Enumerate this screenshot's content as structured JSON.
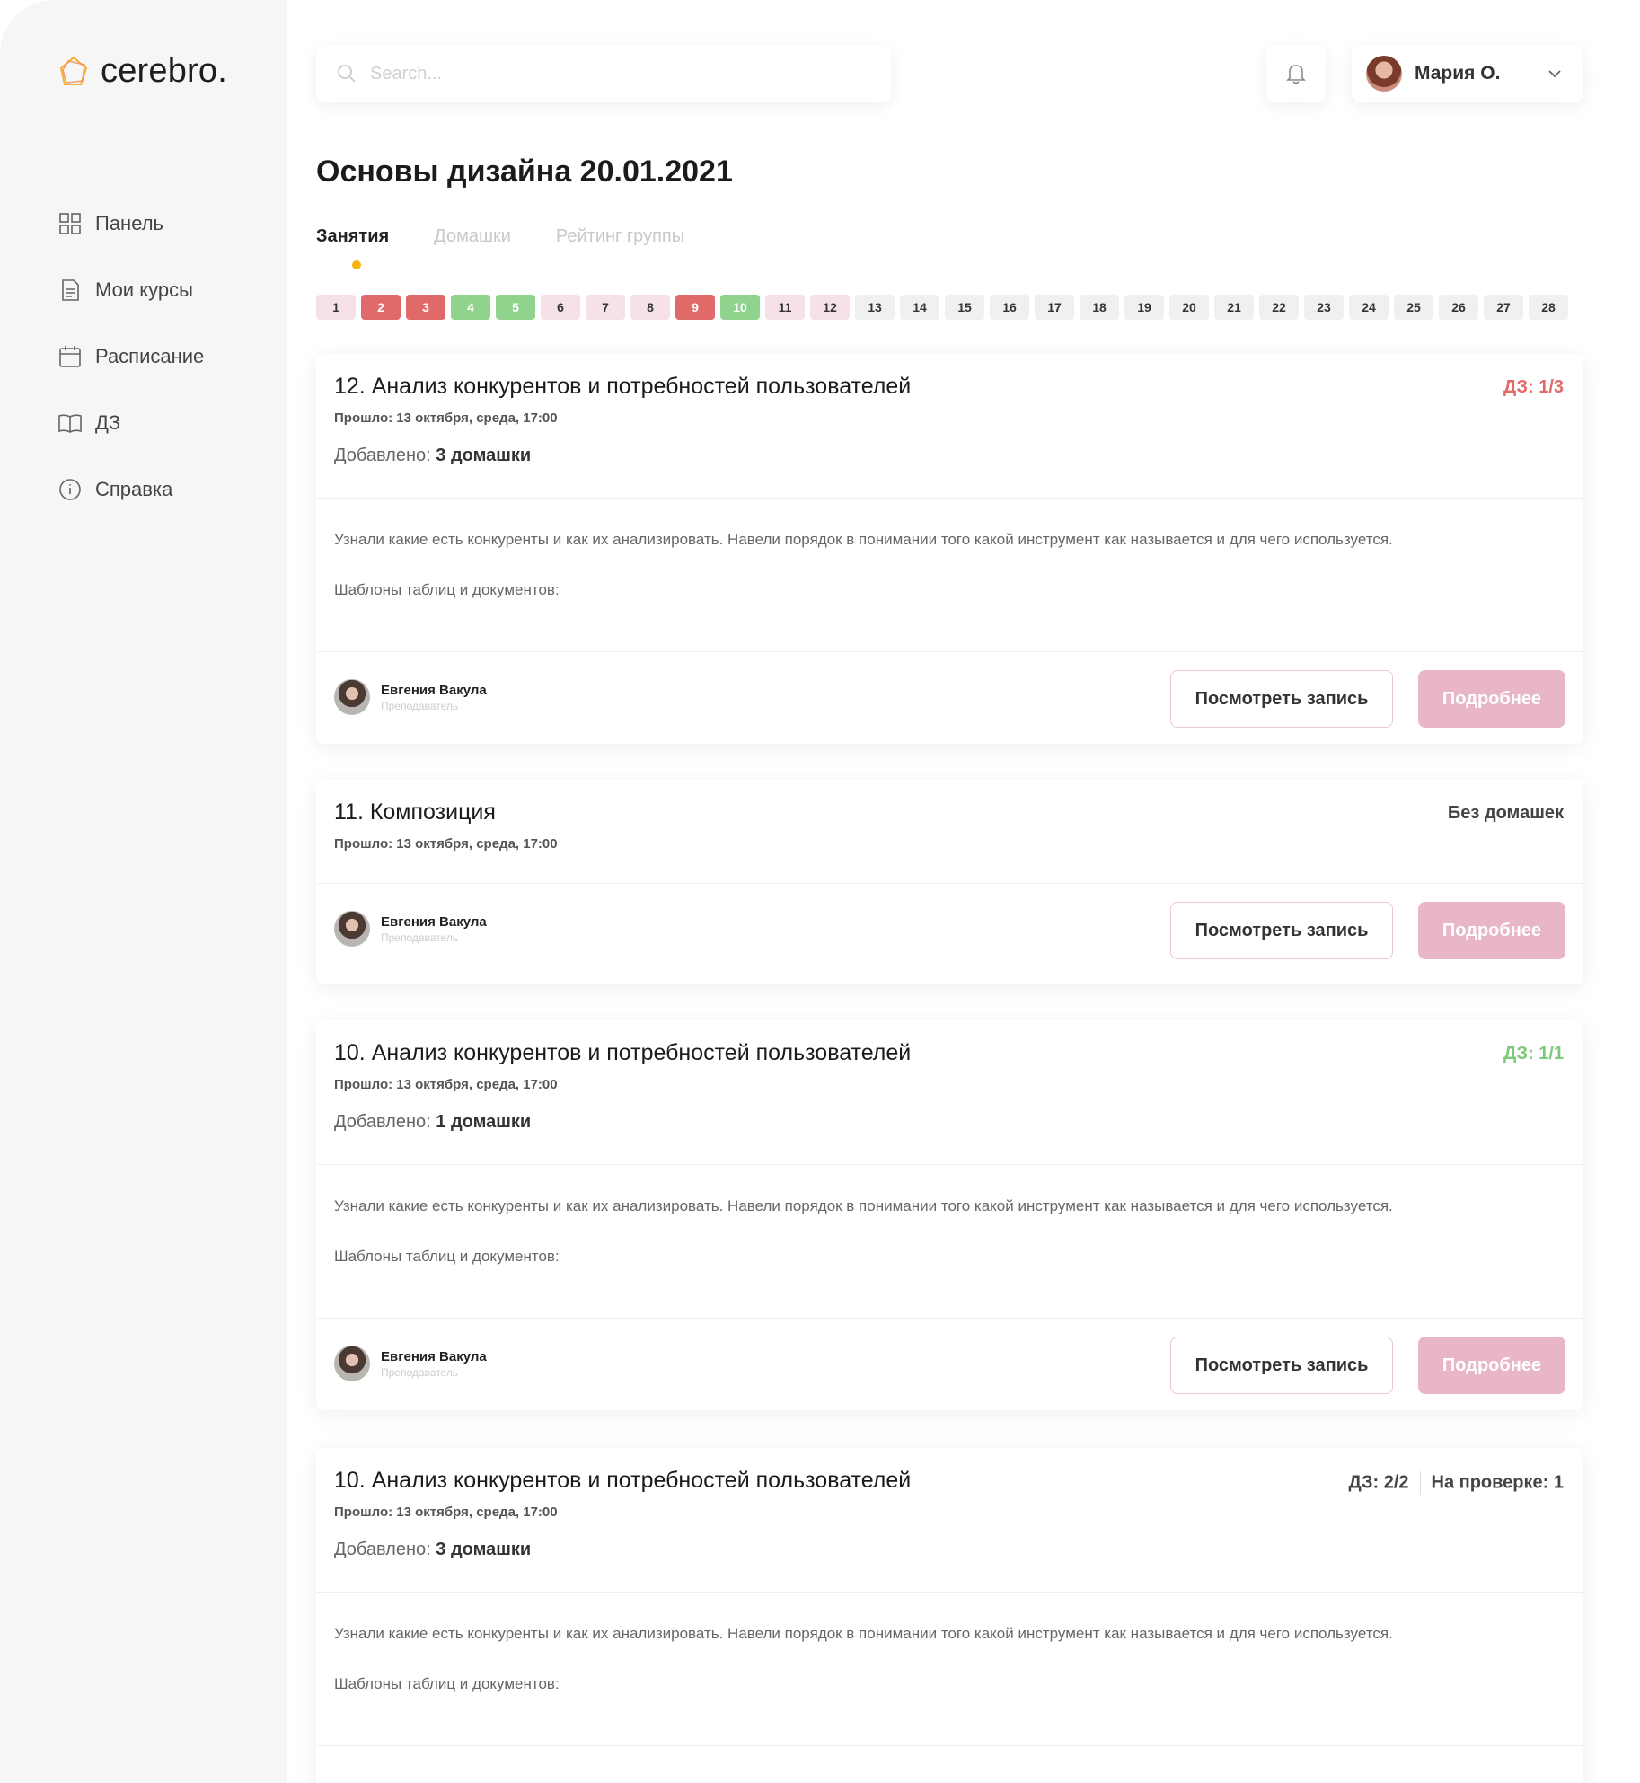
{
  "logo": {
    "text": "cerebro."
  },
  "sidebar": {
    "items": [
      {
        "label": "Панель",
        "icon": "dashboard-icon"
      },
      {
        "label": "Мои курсы",
        "icon": "document-icon"
      },
      {
        "label": "Расписание",
        "icon": "calendar-icon"
      },
      {
        "label": "ДЗ",
        "icon": "book-icon"
      },
      {
        "label": "Справка",
        "icon": "info-icon"
      }
    ]
  },
  "search": {
    "placeholder": "Search..."
  },
  "user": {
    "name": "Мария О."
  },
  "page": {
    "title": "Основы дизайна 20.01.2021"
  },
  "tabs": [
    {
      "label": "Занятия",
      "active": true
    },
    {
      "label": "Домашки",
      "active": false
    },
    {
      "label": "Рейтинг группы",
      "active": false
    }
  ],
  "lessons": [
    {
      "n": "1",
      "state": "pink"
    },
    {
      "n": "2",
      "state": "red"
    },
    {
      "n": "3",
      "state": "red"
    },
    {
      "n": "4",
      "state": "green"
    },
    {
      "n": "5",
      "state": "green"
    },
    {
      "n": "6",
      "state": "pink"
    },
    {
      "n": "7",
      "state": "pink"
    },
    {
      "n": "8",
      "state": "pink"
    },
    {
      "n": "9",
      "state": "red"
    },
    {
      "n": "10",
      "state": "green"
    },
    {
      "n": "11",
      "state": "pink"
    },
    {
      "n": "12",
      "state": "pink"
    },
    {
      "n": "13",
      "state": "grey"
    },
    {
      "n": "14",
      "state": "grey"
    },
    {
      "n": "15",
      "state": "grey"
    },
    {
      "n": "16",
      "state": "grey"
    },
    {
      "n": "17",
      "state": "grey"
    },
    {
      "n": "18",
      "state": "grey"
    },
    {
      "n": "19",
      "state": "grey"
    },
    {
      "n": "20",
      "state": "grey"
    },
    {
      "n": "21",
      "state": "grey"
    },
    {
      "n": "22",
      "state": "grey"
    },
    {
      "n": "23",
      "state": "grey"
    },
    {
      "n": "24",
      "state": "grey"
    },
    {
      "n": "25",
      "state": "grey"
    },
    {
      "n": "26",
      "state": "grey"
    },
    {
      "n": "27",
      "state": "grey"
    },
    {
      "n": "28",
      "state": "grey"
    }
  ],
  "colors": {
    "red": "#e06a6a",
    "green": "#8fd38d",
    "pink": "#f6e1e6",
    "accent": "#e8b6c6",
    "dot": "#f6b40e"
  },
  "cards": [
    {
      "title": "12. Анализ конкурентов и потребностей пользователей",
      "date": "Прошло: 13 октября, среда, 17:00",
      "added_label": "Добавлено:",
      "added_value": "3 домашки",
      "status": "ДЗ: 1/3",
      "description": "Узнали какие есть конкуренты и как их анализировать. Навели порядок в понимании того какой инструмент как называется и для чего используется.",
      "templates": "Шаблоны таблиц и документов:",
      "teacher": "Евгения Вакула",
      "teacher_role": "Преподаватель",
      "btn_record": "Посмотреть запись",
      "btn_more": "Подробнее"
    },
    {
      "title": "11. Композиция",
      "date": "Прошло: 13 октября, среда, 17:00",
      "status": "Без домашек",
      "teacher": "Евгения Вакула",
      "teacher_role": "Преподаватель",
      "btn_record": "Посмотреть запись",
      "btn_more": "Подробнее"
    },
    {
      "title": "10. Анализ конкурентов и потребностей пользователей",
      "date": "Прошло: 13 октября, среда, 17:00",
      "added_label": "Добавлено:",
      "added_value": "1 домашки",
      "status": "ДЗ: 1/1",
      "description": "Узнали какие есть конкуренты и как их анализировать. Навели порядок в понимании того какой инструмент как называется и для чего используется.",
      "templates": "Шаблоны таблиц и документов:",
      "teacher": "Евгения Вакула",
      "teacher_role": "Преподаватель",
      "btn_record": "Посмотреть запись",
      "btn_more": "Подробнее"
    },
    {
      "title": "10. Анализ конкурентов и потребностей пользователей",
      "date": "Прошло: 13 октября, среда, 17:00",
      "added_label": "Добавлено:",
      "added_value": "3 домашки",
      "status": "ДЗ: 2/2",
      "status_extra": "На проверке: 1",
      "description": "Узнали какие есть конкуренты и как их анализировать. Навели порядок в понимании того какой инструмент как называется и для чего используется.",
      "templates": "Шаблоны таблиц и документов:"
    }
  ]
}
